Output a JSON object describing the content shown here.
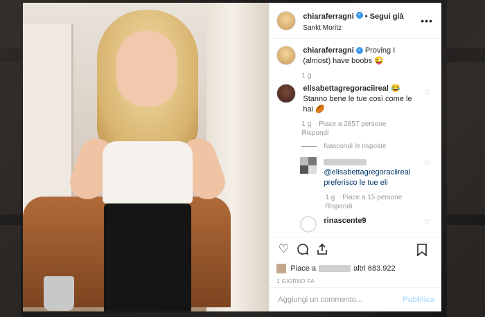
{
  "post": {
    "author": "chiaraferragni",
    "follow_label": "• Segui già",
    "location": "Sankt Moritz",
    "more_label": "•••"
  },
  "caption": {
    "author": "chiaraferragni",
    "text": "Proving I (almost) have boobs 😜",
    "age": "1 g"
  },
  "comments": [
    {
      "author": "elisabettagregoraciireal",
      "text": "😂 Stanno bene le tue così come le hai 🏉",
      "age": "1 g",
      "likes": "Piace a 2857 persone",
      "reply_label": "Rispondi",
      "hide_replies": "Nascondi le risposte",
      "replies": [
        {
          "text": "@elisabettagregoraciireal preferisco le tue eli",
          "age": "1 g",
          "likes": "Piace a 15 persone",
          "reply_label": "Rispondi"
        }
      ]
    },
    {
      "author": "rinascente9"
    }
  ],
  "likes_summary": {
    "prefix": "Piace a",
    "suffix": "altri 683.922"
  },
  "timestamp": "1 GIORNO FA",
  "comment_box": {
    "placeholder": "Aggiungi un commento...",
    "publish_label": "Pubblica"
  },
  "icons": [
    "heart-icon",
    "comment-icon",
    "share-icon",
    "bookmark-icon",
    "verified-icon"
  ],
  "colors": {
    "verified": "#3897f0",
    "publish": "#b3dbff",
    "text": "#262626",
    "muted": "#999999"
  }
}
